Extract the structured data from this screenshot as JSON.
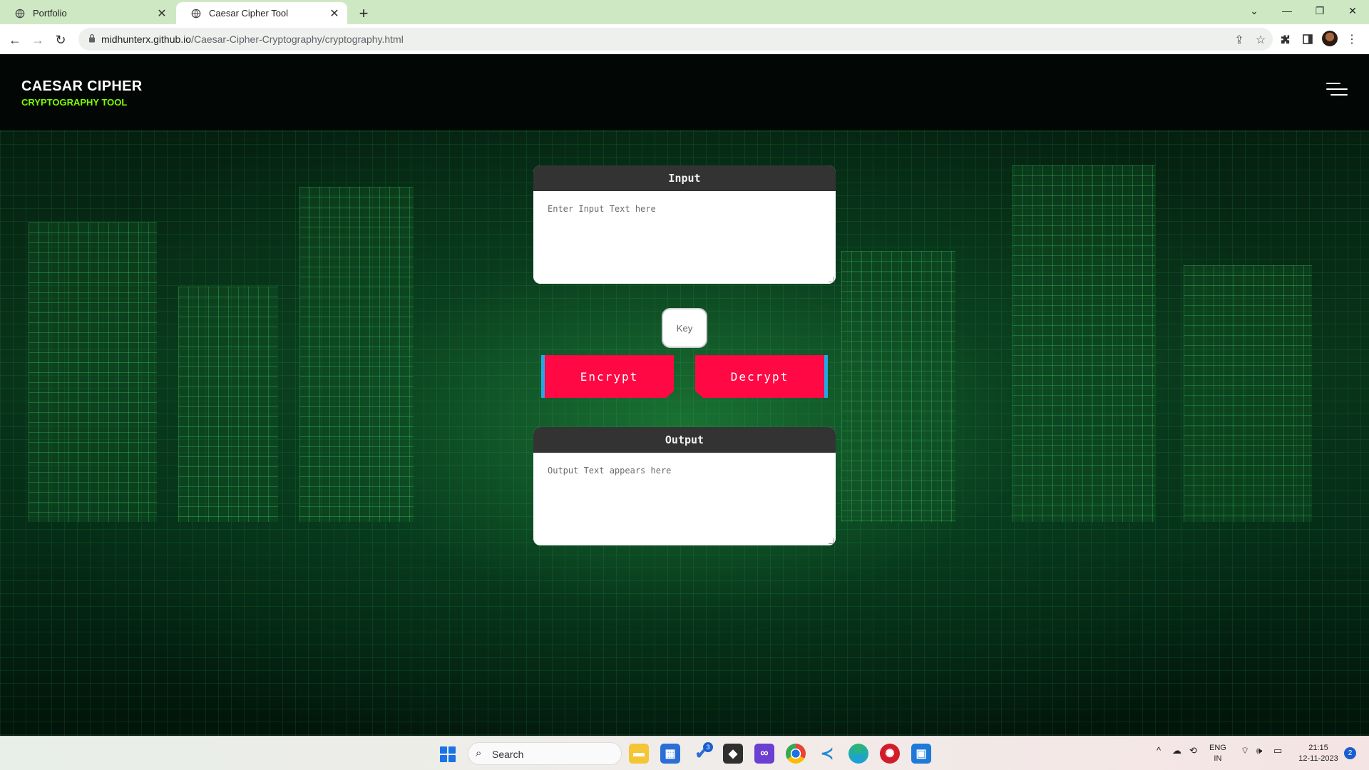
{
  "browser": {
    "tabs": [
      {
        "title": "Portfolio",
        "active": false
      },
      {
        "title": "Caesar Cipher Tool",
        "active": true
      }
    ],
    "url_host": "midhunterx.github.io",
    "url_path": "/Caesar-Cipher-Cryptography/cryptography.html"
  },
  "header": {
    "title": "CAESAR CIPHER",
    "subtitle": "CRYPTOGRAPHY TOOL",
    "subtitle_color": "#7cff00"
  },
  "input_panel": {
    "label": "Input",
    "placeholder": "Enter Input Text here",
    "value": ""
  },
  "key_field": {
    "placeholder": "Key",
    "value": ""
  },
  "buttons": {
    "encrypt": "Encrypt",
    "decrypt": "Decrypt",
    "color": "#ff0844",
    "accent": "#27a6e6"
  },
  "output_panel": {
    "label": "Output",
    "placeholder": "Output Text appears here",
    "value": ""
  },
  "taskbar": {
    "search_label": "Search",
    "apps": [
      "file-explorer",
      "microsoft-store",
      "todo",
      "unity",
      "visual-studio",
      "chrome",
      "vscode",
      "edge-canary",
      "app-red",
      "app-blue"
    ],
    "todo_badge": "3",
    "language_top": "ENG",
    "language_bottom": "IN",
    "time": "21:15",
    "date": "12-11-2023",
    "notifications": "2"
  }
}
